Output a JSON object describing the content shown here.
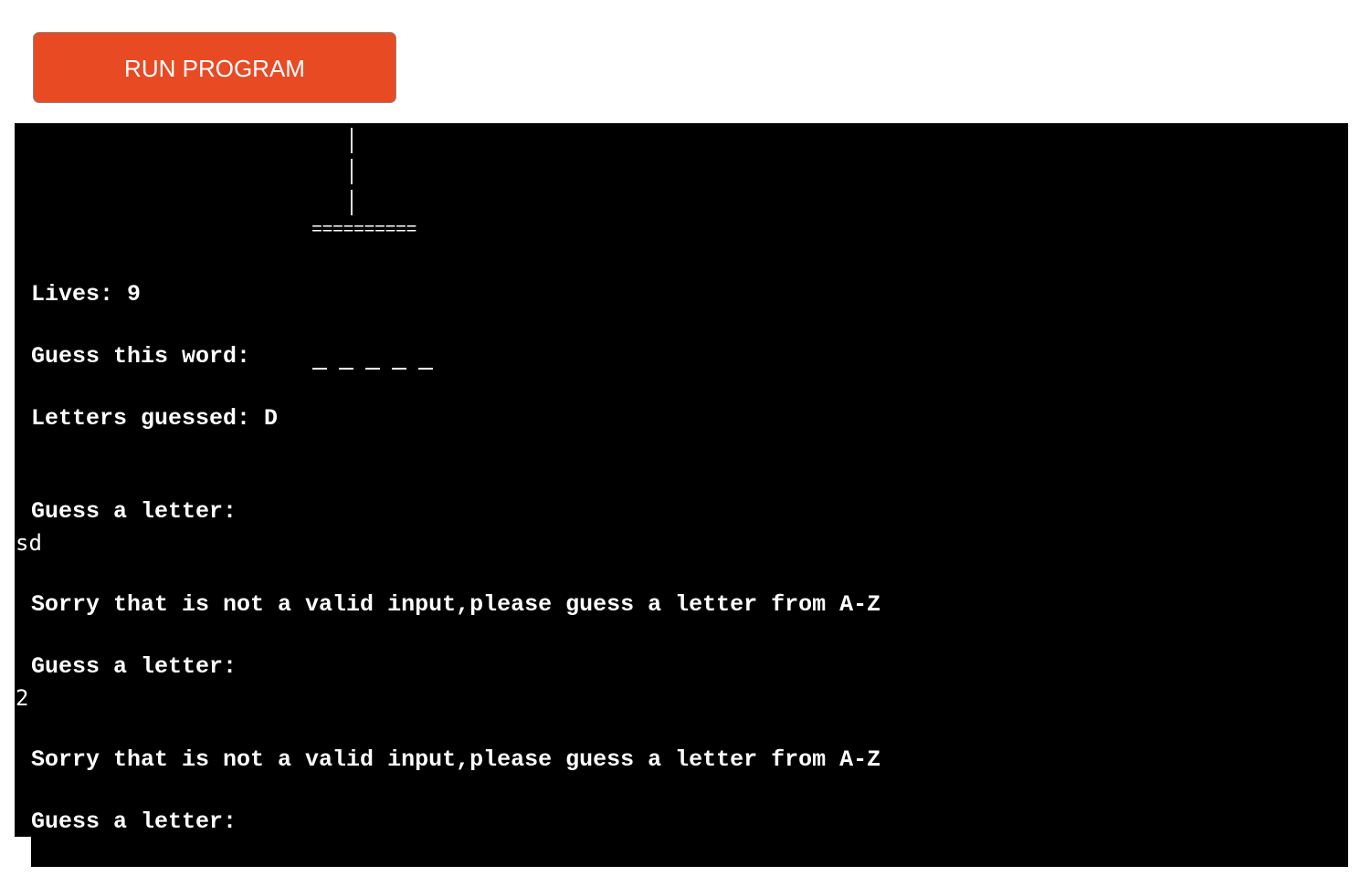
{
  "toolbar": {
    "run_label": "RUN PROGRAM",
    "run_color": "#e84a24"
  },
  "terminal": {
    "background": "#000000",
    "gallows_base": "==========",
    "lives_line": "Lives: 9",
    "word_line": "Guess this word:",
    "word_blanks": [
      "_",
      "_",
      "_",
      "_",
      "_"
    ],
    "letters_line": "Letters guessed: D",
    "prompt_1": "Guess a letter:",
    "input_1": "sd",
    "error_1": "Sorry that is not a valid input,please guess a letter from A-Z",
    "prompt_2": "Guess a letter:",
    "input_2": "2",
    "error_2": "Sorry that is not a valid input,please guess a letter from A-Z",
    "prompt_3": "Guess a letter:"
  }
}
